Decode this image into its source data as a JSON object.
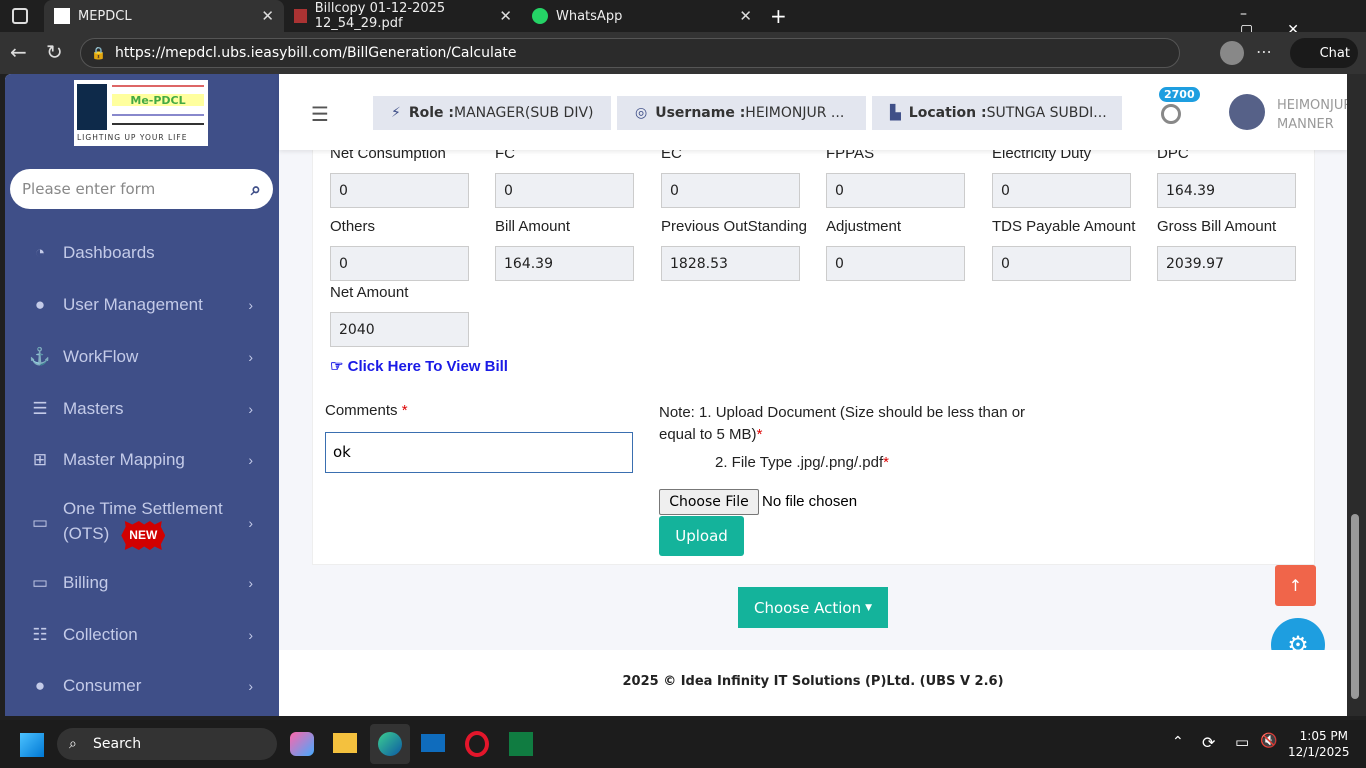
{
  "browser": {
    "tabs": [
      {
        "title": "MEPDCL",
        "active": true
      },
      {
        "title": "Billcopy 01-12-2025 12_54_29.pdf"
      },
      {
        "title": "WhatsApp"
      }
    ],
    "url": "https://mepdcl.ubs.ieasybill.com/BillGeneration/Calculate",
    "chat_label": "Chat"
  },
  "sidebar": {
    "logo_text": "Me-PDCL",
    "logo_tagline": "LIGHTING UP YOUR LIFE",
    "search_placeholder": "Please enter form",
    "items": [
      {
        "label": "Dashboards",
        "icon": "dashboard-icon"
      },
      {
        "label": "User Management",
        "icon": "user-icon"
      },
      {
        "label": "WorkFlow",
        "icon": "anchor-icon"
      },
      {
        "label": "Masters",
        "icon": "server-icon"
      },
      {
        "label": "Master Mapping",
        "icon": "sitemap-icon"
      },
      {
        "label": "One Time Settlement",
        "label2": "(OTS)",
        "badge": "NEW",
        "icon": "monitor-icon"
      },
      {
        "label": "Billing",
        "icon": "monitor-icon"
      },
      {
        "label": "Collection",
        "icon": "list-ol-icon"
      },
      {
        "label": "Consumer",
        "icon": "user-icon"
      }
    ]
  },
  "header": {
    "role_label": "Role :",
    "role_value": "MANAGER(SUB DIV)",
    "username_label": "Username :",
    "username_value": "HEIMONJUR ...",
    "location_label": "Location :",
    "location_value": "SUTNGA SUBDI...",
    "notification_count": "2700",
    "user_name_line1": "HEIMONJUR",
    "user_name_line2": "MANNER"
  },
  "form": {
    "fields": [
      {
        "label": "Net Consumption",
        "value": "0"
      },
      {
        "label": "FC",
        "value": "0"
      },
      {
        "label": "EC",
        "value": "0"
      },
      {
        "label": "FPPAS",
        "value": "0"
      },
      {
        "label": "Electricity Duty",
        "value": "0"
      },
      {
        "label": "DPC",
        "value": "164.39"
      },
      {
        "label": "Others",
        "value": "0"
      },
      {
        "label": "Bill Amount",
        "value": "164.39"
      },
      {
        "label": "Previous OutStanding",
        "value": "1828.53"
      },
      {
        "label": "Adjustment",
        "value": "0"
      },
      {
        "label": "TDS Payable Amount",
        "value": "0"
      },
      {
        "label": "Gross Bill Amount",
        "value": "2039.97"
      },
      {
        "label": "Net Amount",
        "value": "2040"
      }
    ],
    "view_bill_link": "Click Here To View Bill",
    "comments_label": "Comments",
    "comments_value": "ok",
    "required": "*",
    "note_line1": "Note: 1. Upload Document (Size should be less than or equal to 5 MB)",
    "note_line2": "2. File Type .jpg/.png/.pdf",
    "choose_file": "Choose File",
    "no_file": "No file chosen",
    "upload": "Upload",
    "choose_action": "Choose Action"
  },
  "footer": "2025 © Idea Infinity IT Solutions (P)Ltd. (UBS V 2.6)",
  "taskbar": {
    "search": "Search",
    "time": "1:05 PM",
    "date": "12/1/2025"
  },
  "colors": {
    "sidebar": "#3f4f88",
    "accent": "#14b39b",
    "scroll_top": "#f0654a",
    "settings": "#1e9ee0"
  }
}
